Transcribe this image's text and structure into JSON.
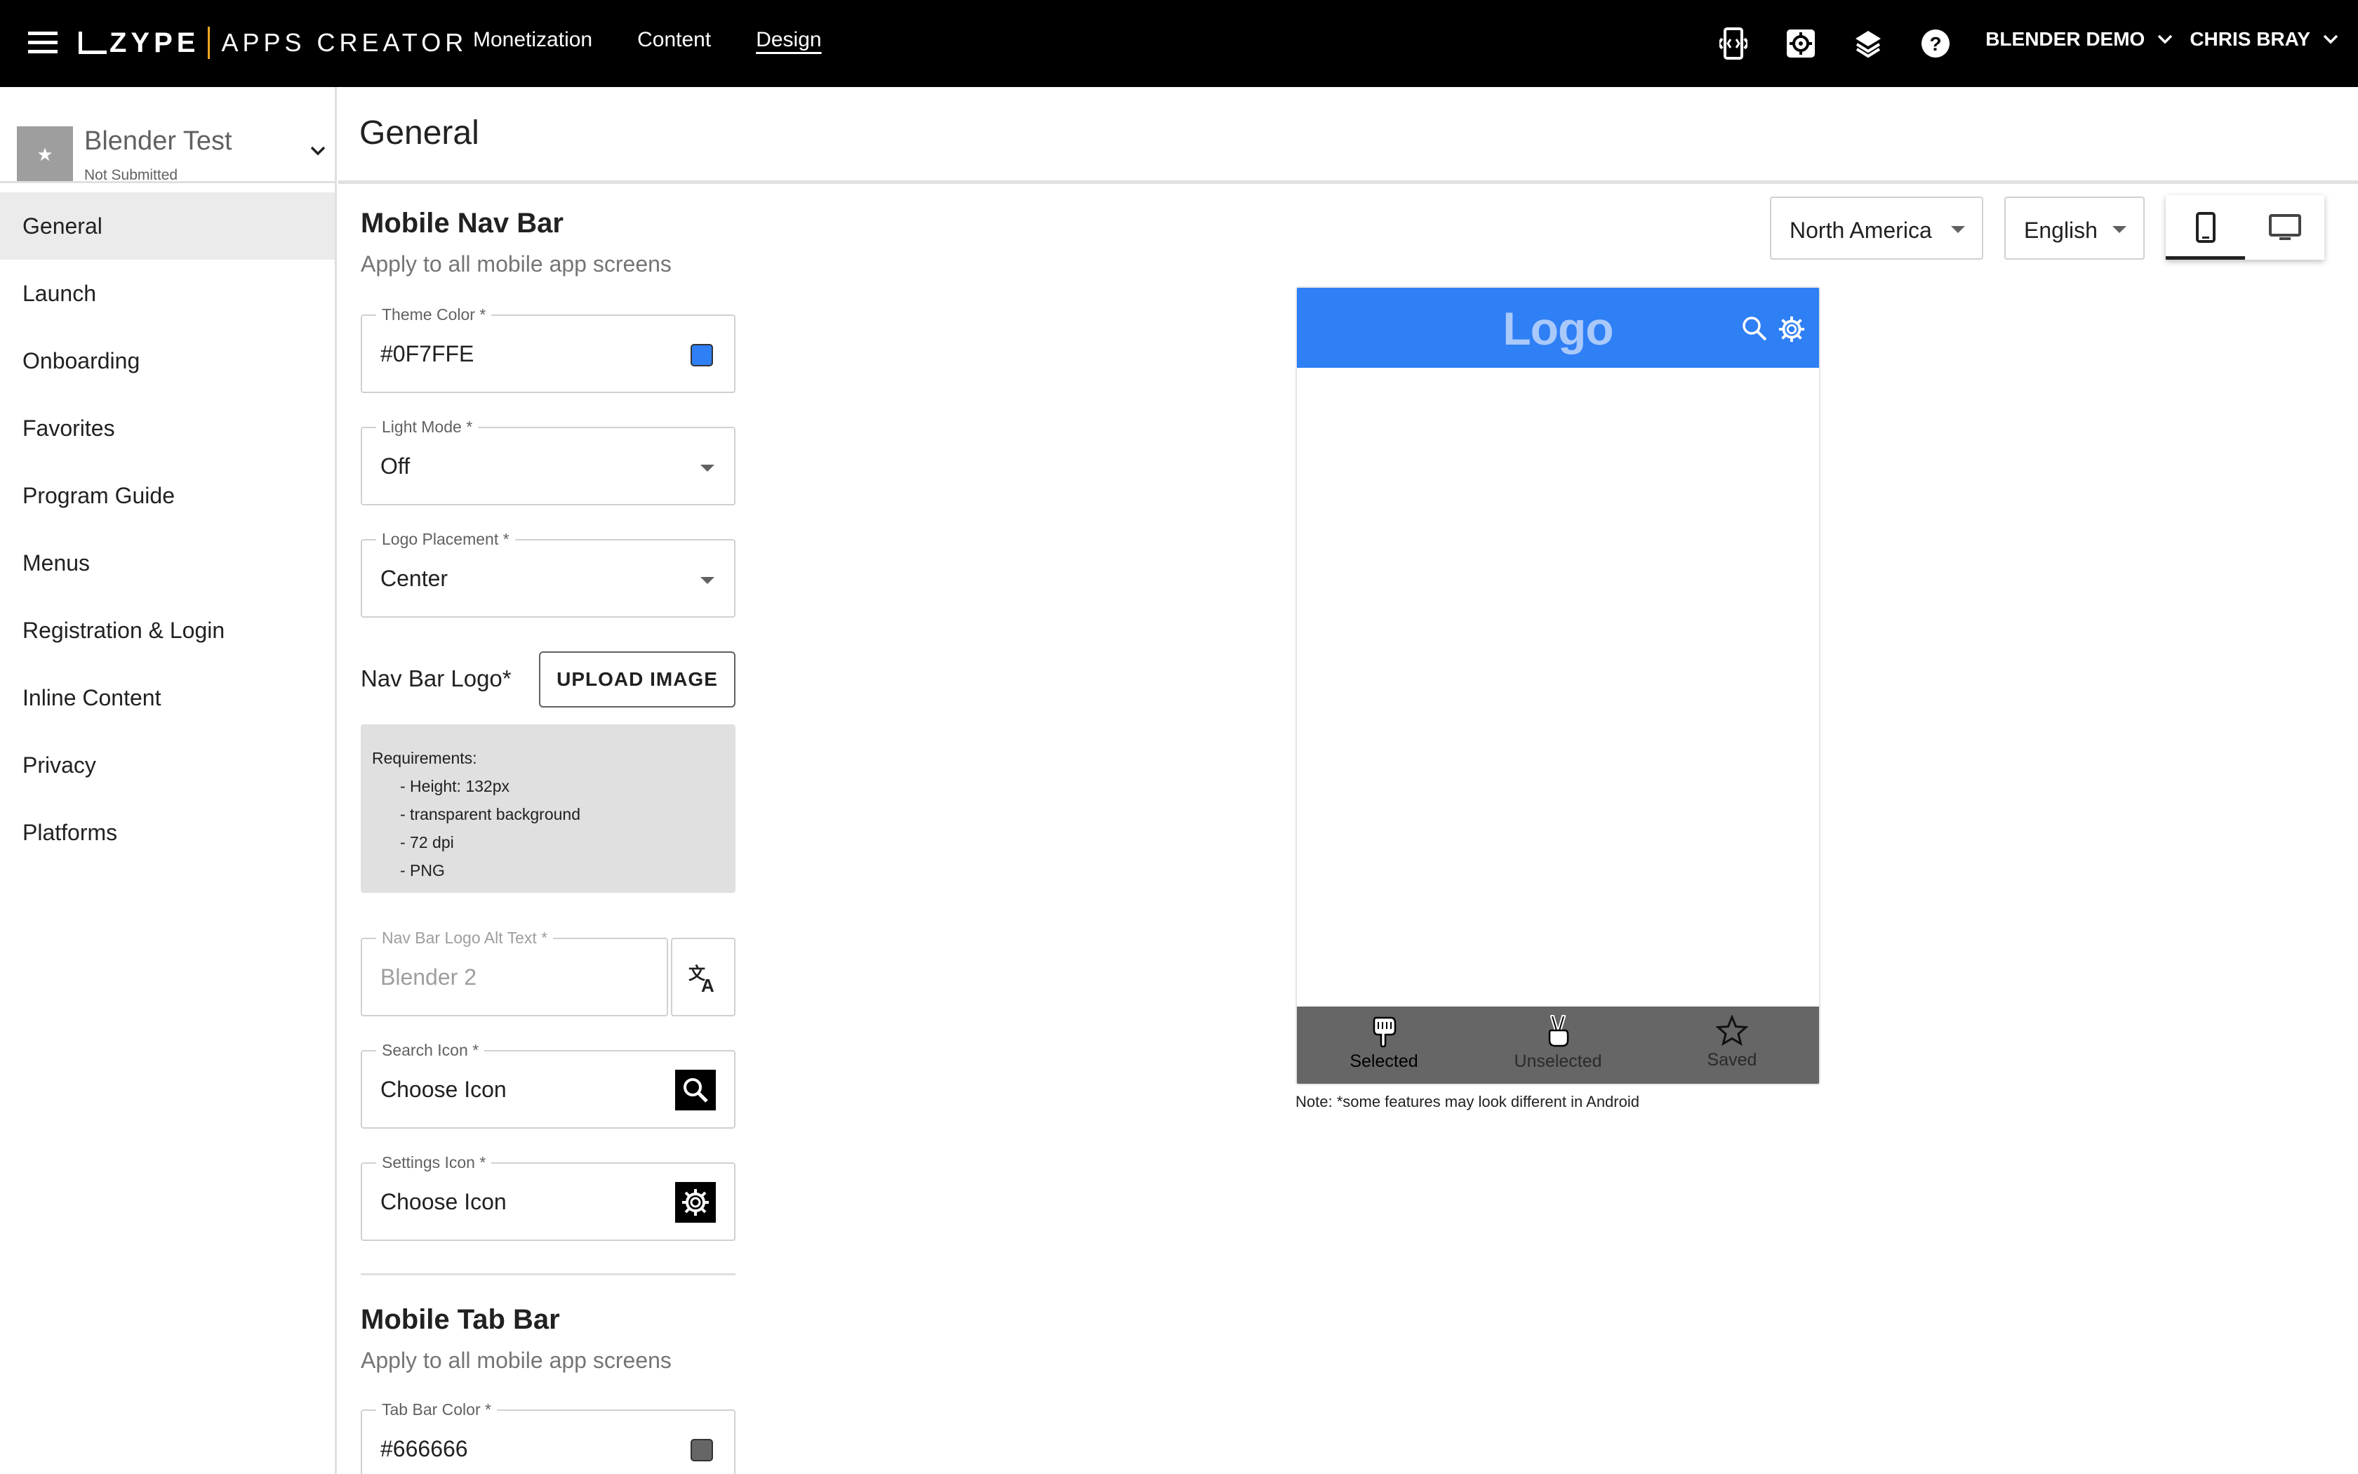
{
  "header": {
    "brand_left": "ZYPE",
    "brand_right": "APPS CREATOR",
    "nav": [
      "Monetization",
      "Content",
      "Design"
    ],
    "active_nav": "Design",
    "account": "BLENDER DEMO",
    "user": "CHRIS BRAY",
    "icons": [
      "code-phone-icon",
      "settings-icon",
      "layers-icon",
      "help-icon"
    ]
  },
  "project": {
    "name": "Blender Test",
    "status": "Not Submitted"
  },
  "sidebar": {
    "items": [
      {
        "label": "General",
        "active": true
      },
      {
        "label": "Launch"
      },
      {
        "label": "Onboarding"
      },
      {
        "label": "Favorites"
      },
      {
        "label": "Program Guide"
      },
      {
        "label": "Menus"
      },
      {
        "label": "Registration & Login"
      },
      {
        "label": "Inline Content"
      },
      {
        "label": "Privacy"
      },
      {
        "label": "Platforms"
      }
    ]
  },
  "page": {
    "title": "General"
  },
  "nav_bar_section": {
    "title": "Mobile Nav Bar",
    "subtitle": "Apply to all mobile app screens",
    "theme_color": {
      "label": "Theme Color *",
      "value": "#0F7FFE",
      "swatch": "#2f7ff5"
    },
    "light_mode": {
      "label": "Light Mode *",
      "value": "Off"
    },
    "logo_placement": {
      "label": "Logo Placement *",
      "value": "Center"
    },
    "logo_label": "Nav Bar Logo*",
    "upload_button": "UPLOAD IMAGE",
    "requirements": {
      "title": "Requirements:",
      "items": [
        "- Height: 132px",
        "- transparent background",
        "- 72 dpi",
        "- PNG"
      ]
    },
    "alt_text": {
      "label": "Nav Bar Logo Alt Text *",
      "placeholder": "Blender 2"
    },
    "search_icon": {
      "label": "Search Icon *",
      "value": "Choose Icon"
    },
    "settings_icon": {
      "label": "Settings Icon *",
      "value": "Choose Icon"
    }
  },
  "tab_bar_section": {
    "title": "Mobile Tab Bar",
    "subtitle": "Apply to all mobile app screens",
    "tab_bar_color": {
      "label": "Tab Bar Color *",
      "value": "#666666",
      "swatch": "#666666"
    }
  },
  "preview": {
    "region": "North America",
    "language": "English",
    "logo_text": "Logo",
    "nav_color": "#2f7ff5",
    "tab_color": "#666666",
    "tabs": [
      {
        "label": "Selected",
        "icon": "hand-pointing-down-icon"
      },
      {
        "label": "Unselected",
        "icon": "peace-hand-icon"
      },
      {
        "label": "Saved",
        "icon": "star-icon"
      }
    ],
    "note": "Note: *some features may look different in Android"
  }
}
